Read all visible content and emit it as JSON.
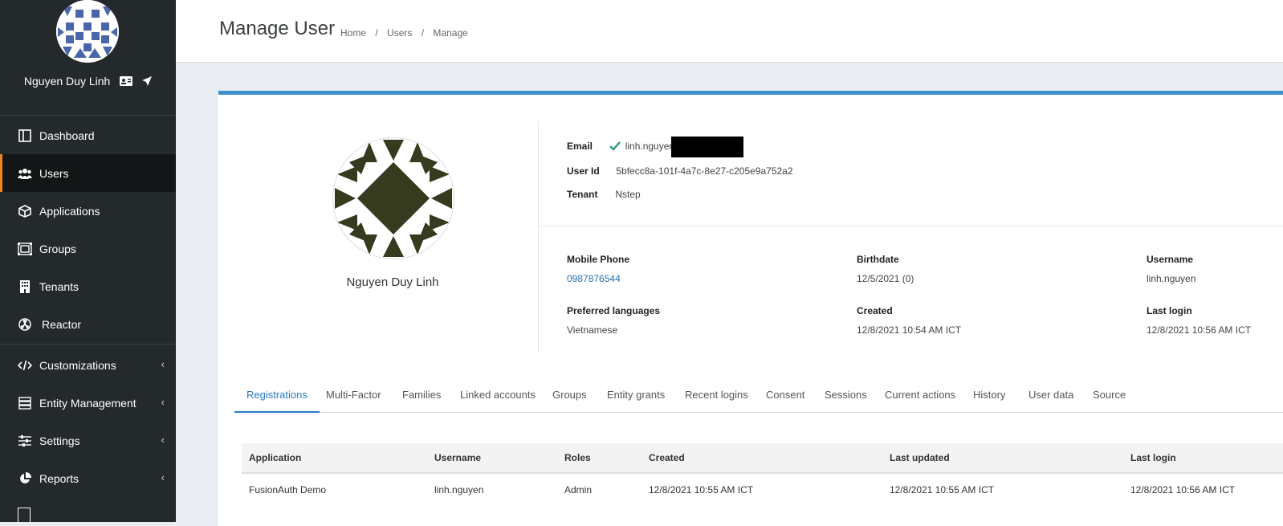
{
  "sidebar": {
    "user_name": "Nguyen Duy Linh",
    "items": [
      {
        "label": "Dashboard",
        "icon": "dashboard-icon"
      },
      {
        "label": "Users",
        "icon": "users-icon",
        "active": true
      },
      {
        "label": "Applications",
        "icon": "cube-icon"
      },
      {
        "label": "Groups",
        "icon": "groups-icon"
      },
      {
        "label": "Tenants",
        "icon": "building-icon"
      },
      {
        "label": "Reactor",
        "icon": "reactor-icon"
      },
      {
        "label": "Customizations",
        "icon": "code-icon",
        "chevron": "‹"
      },
      {
        "label": "Entity Management",
        "icon": "server-icon",
        "chevron": "‹"
      },
      {
        "label": "Settings",
        "icon": "sliders-icon",
        "chevron": "‹"
      },
      {
        "label": "Reports",
        "icon": "pie-chart-icon",
        "chevron": "‹"
      }
    ],
    "active_accent": "#f58320"
  },
  "header": {
    "title": "Manage User",
    "breadcrumb": [
      "Home",
      "Users",
      "Manage"
    ],
    "separator": "/"
  },
  "profile": {
    "name": "Nguyen Duy Linh",
    "email_label": "Email",
    "email_value": "linh.nguyen",
    "user_id_label": "User Id",
    "user_id_value": "5bfecc8a-101f-4a7c-8e27-c205e9a752a2",
    "tenant_label": "Tenant",
    "tenant_value": "Nstep",
    "mobile_label": "Mobile Phone",
    "mobile_value": "0987876544",
    "birthdate_label": "Birthdate",
    "birthdate_value": "12/5/2021 (0)",
    "username_label": "Username",
    "username_value": "linh.nguyen",
    "languages_label": "Preferred languages",
    "languages_value": "Vietnamese",
    "created_label": "Created",
    "created_value": "12/8/2021 10:54 AM ICT",
    "lastlogin_label": "Last login",
    "lastlogin_value": "12/8/2021 10:56 AM ICT"
  },
  "tabs": [
    "Registrations",
    "Multi-Factor",
    "Families",
    "Linked accounts",
    "Groups",
    "Entity grants",
    "Recent logins",
    "Consent",
    "Sessions",
    "Current actions",
    "History",
    "User data",
    "Source"
  ],
  "table": {
    "headers": [
      "Application",
      "Username",
      "Roles",
      "Created",
      "Last updated",
      "Last login"
    ],
    "rows": [
      [
        "FusionAuth Demo",
        "linh.nguyen",
        "Admin",
        "12/8/2021 10:55 AM ICT",
        "12/8/2021 10:55 AM ICT",
        "12/8/2021 10:56 AM ICT"
      ]
    ]
  },
  "colors": {
    "accent": "#3b91d0",
    "sidebar": "#24292b",
    "check": "#2b9a7f"
  }
}
